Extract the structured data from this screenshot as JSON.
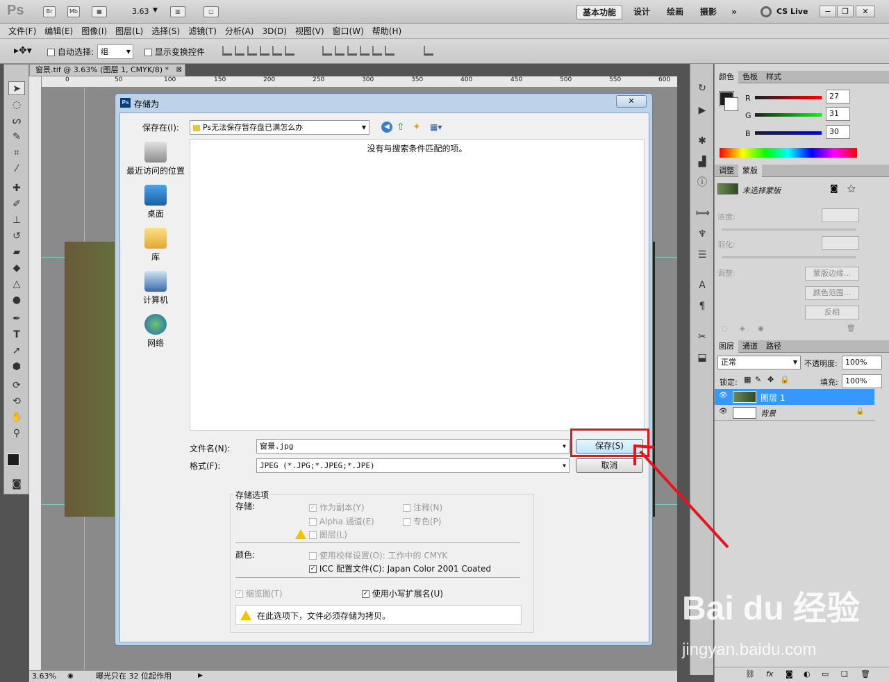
{
  "app": {
    "logo": "Ps",
    "zoom_value": "3.63",
    "workspaces": [
      "基本功能",
      "设计",
      "绘画",
      "摄影"
    ],
    "cs_live": "CS Live"
  },
  "menu": [
    "文件(F)",
    "编辑(E)",
    "图像(I)",
    "图层(L)",
    "选择(S)",
    "滤镜(T)",
    "分析(A)",
    "3D(D)",
    "视图(V)",
    "窗口(W)",
    "帮助(H)"
  ],
  "options": {
    "auto_select_label": "自动选择:",
    "auto_select_value": "组",
    "show_transform_label": "显示变换控件"
  },
  "document": {
    "tab_title": "窗景.tif @ 3.63% (图层 1, CMYK/8) *",
    "ruler_ticks": [
      "0",
      "50",
      "100",
      "150",
      "200",
      "250",
      "300",
      "350",
      "400",
      "450",
      "500",
      "550",
      "600"
    ],
    "status_zoom": "3.63%",
    "status_text": "曝光只在 32 位起作用"
  },
  "color_panel": {
    "tabs": [
      "颜色",
      "色板",
      "样式"
    ],
    "r_label": "R",
    "g_label": "G",
    "b_label": "B",
    "r": "27",
    "g": "31",
    "b": "30"
  },
  "adjust_panel": {
    "tabs": [
      "调整",
      "蒙版"
    ],
    "mask_title": "未选择蒙版",
    "density_label": "浓度:",
    "feather_label": "羽化:",
    "refine_label": "调整:",
    "mask_edge_btn": "蒙版边缘...",
    "color_range_btn": "颜色范围...",
    "invert_btn": "反相"
  },
  "layers_panel": {
    "tabs": [
      "图层",
      "通道",
      "路径"
    ],
    "blend_mode": "正常",
    "opacity_label": "不透明度:",
    "opacity_value": "100%",
    "lock_label": "锁定:",
    "fill_label": "填充:",
    "fill_value": "100%",
    "layers": [
      {
        "name": "图层 1",
        "selected": true
      },
      {
        "name": "背景",
        "selected": false
      }
    ]
  },
  "dialog": {
    "title": "存储为",
    "close": "✕",
    "save_in_label": "保存在(I):",
    "save_in_value": "Ps无法保存暂存盘已满怎么办",
    "places": [
      "最近访问的位置",
      "桌面",
      "库",
      "计算机",
      "网络"
    ],
    "empty_message": "没有与搜索条件匹配的项。",
    "filename_label": "文件名(N):",
    "filename_value": "窗景.jpg",
    "format_label": "格式(F):",
    "format_value": "JPEG (*.JPG;*.JPEG;*.JPE)",
    "save_button": "保存(S)",
    "cancel_button": "取消",
    "options_group": "存储选项",
    "save_label": "存储:",
    "as_copy": "作为副本(Y)",
    "notes": "注释(N)",
    "alpha": "Alpha 通道(E)",
    "spot": "专色(P)",
    "layers": "图层(L)",
    "color_label": "颜色:",
    "proof_setup": "使用校样设置(O):",
    "proof_value": "工作中的 CMYK",
    "icc_profile": "ICC 配置文件(C):",
    "icc_value": "Japan Color 2001 Coated",
    "thumbnail": "缩览图(T)",
    "lowercase_ext": "使用小写扩展名(U)",
    "warning": "在此选项下，文件必须存储为拷贝。"
  },
  "watermark": {
    "brand": "Bai du 经验",
    "url": "jingyan.baidu.com"
  },
  "colors": {
    "highlight": "#e8141b",
    "selection": "#3399ff"
  }
}
